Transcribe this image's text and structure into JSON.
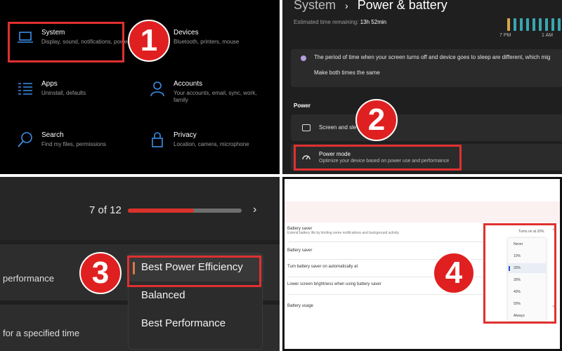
{
  "panel1": {
    "tiles": [
      {
        "title": "System",
        "desc": "Display, sound, notifications, power",
        "icon": "laptop-icon"
      },
      {
        "title": "Devices",
        "desc": "Bluetooth, printers, mouse",
        "icon": "devices-icon"
      },
      {
        "title": "Apps",
        "desc": "Uninstall, defaults",
        "icon": "apps-list-icon"
      },
      {
        "title": "Accounts",
        "desc": "Your accounts, email, sync, work, family",
        "icon": "person-icon"
      },
      {
        "title": "Search",
        "desc": "Find my files, permissions",
        "icon": "search-icon"
      },
      {
        "title": "Privacy",
        "desc": "Location, camera, microphone",
        "icon": "lock-icon"
      }
    ],
    "badge": "1"
  },
  "panel2": {
    "breadcrumb_parent": "System",
    "breadcrumb_sep": "›",
    "breadcrumb_current": "Power & battery",
    "estimate_label": "Estimated time remaining:",
    "estimate_value": "13h 52min",
    "time_labels": [
      "7 PM",
      "1 AM"
    ],
    "info_text": "The period of time when your screen turns off and device goes to sleep are different, which mig",
    "info_link": "Make both times the same",
    "section_label": "Power",
    "screen_item": "Screen and sle",
    "power_mode_title": "Power mode",
    "power_mode_desc": "Optimize your device based on power use and performance",
    "badge": "2"
  },
  "panel3": {
    "counter": "7 of 12",
    "progress_fraction": 0.58,
    "next_glyph": "›",
    "performance_text": "performance",
    "time_text": "for a specified time",
    "options": [
      "Best Power Efficiency",
      "Balanced",
      "Best Performance"
    ],
    "selected": "Best Power Efficiency",
    "badge": "3"
  },
  "panel4": {
    "rows": [
      {
        "title": "Battery saver",
        "sub": "Extend battery life by limiting some notifications and background activity"
      },
      {
        "title": "Battery saver",
        "sub": ""
      },
      {
        "title": "Turn battery saver on automatically at",
        "sub": ""
      },
      {
        "title": "Lower screen brightness when using battery saver",
        "sub": ""
      },
      {
        "title": "Battery usage",
        "sub": ""
      }
    ],
    "turns_on": "Turns on at 20%",
    "dropdown_options": [
      "Never",
      "10%",
      "20%",
      "30%",
      "40%",
      "50%",
      "Always"
    ],
    "selected_option": "20%",
    "badge": "4"
  },
  "colors": {
    "badge_red": "#e02020",
    "highlight_box": "#e03030",
    "progress_red": "#d9312b",
    "win_blue": "#3b8ee8",
    "battery_teal": "#3aa6b0"
  }
}
